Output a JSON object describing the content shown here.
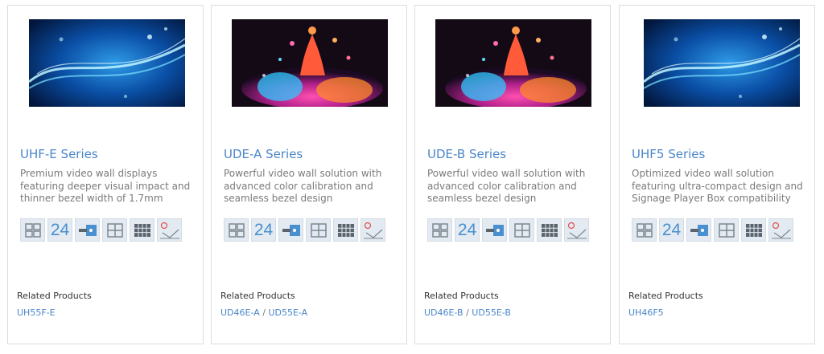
{
  "cards": [
    {
      "title": "UHF-E Series",
      "desc": [
        "Premium video wall displays",
        "featuring deeper visual impact and",
        "thinner bezel width of 1.7mm"
      ],
      "badge_number": "24",
      "related_label": "Related Products",
      "related": [
        "UH55F-E"
      ],
      "image": "blue-light-waves"
    },
    {
      "title": "UDE-A Series",
      "desc": [
        "Powerful video wall solution with",
        "advanced color calibration and",
        "seamless bezel design"
      ],
      "badge_number": "24",
      "related_label": "Related Products",
      "related": [
        "UD46E-A",
        "UD55E-A"
      ],
      "image": "color-splash"
    },
    {
      "title": "UDE-B Series",
      "desc": [
        "Powerful video wall solution with",
        "advanced color calibration and",
        "seamless bezel design"
      ],
      "badge_number": "24",
      "related_label": "Related Products",
      "related": [
        "UD46E-B",
        "UD55E-B"
      ],
      "image": "color-splash"
    },
    {
      "title": "UHF5 Series",
      "desc": [
        "Optimized video wall solution",
        "featuring ultra-compact design and",
        "Signage Player Box compatibility"
      ],
      "badge_number": "24",
      "related_label": "Related Products",
      "related": [
        "UH46F5"
      ],
      "image": "blue-light-waves"
    }
  ],
  "related_separator": " / ",
  "feature_icons": [
    "video-wall-grid-icon",
    "24-hour-operation-icon",
    "media-player-icon",
    "quad-screen-icon",
    "multi-screen-grid-icon",
    "color-calibration-icon"
  ],
  "colors": {
    "title": "#4a86c8",
    "icon_bg": "#e3eaf1",
    "icon_accent": "#4a90d0"
  }
}
